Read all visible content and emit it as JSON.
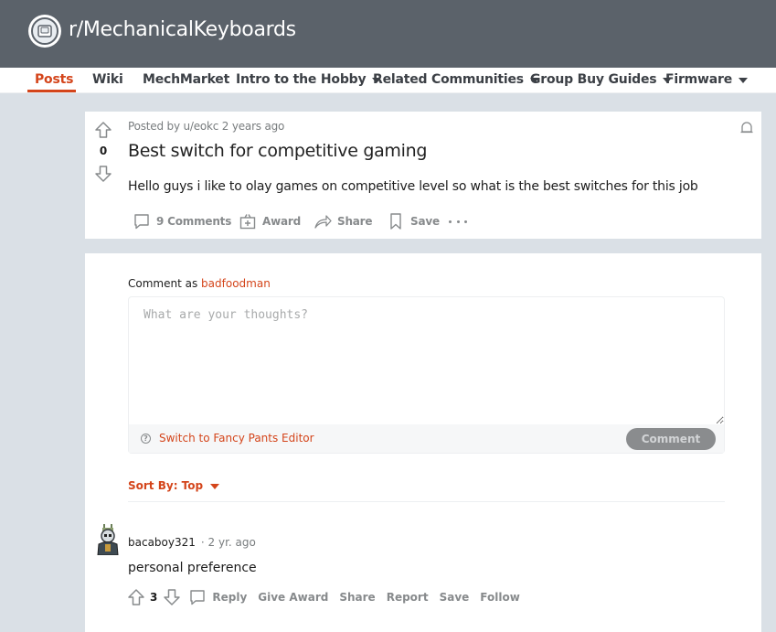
{
  "subreddit": {
    "title": "r/MechanicalKeyboards"
  },
  "nav": {
    "items": [
      {
        "label": "Posts",
        "active": true,
        "dropdown": false
      },
      {
        "label": "Wiki",
        "dropdown": false
      },
      {
        "label": "MechMarket",
        "dropdown": false
      },
      {
        "label": "Intro to the Hobby",
        "dropdown": true
      },
      {
        "label": "Related Communities",
        "dropdown": true
      },
      {
        "label": "Group Buy Guides",
        "dropdown": true
      },
      {
        "label": "Firmware",
        "dropdown": true
      }
    ]
  },
  "post": {
    "meta": "Posted by u/eokc 2 years ago",
    "score": "0",
    "title": "Best switch for competitive gaming",
    "body": "Hello guys i like to olay games on competitive level so what is the best switches for this job",
    "actions": {
      "comments": "9 Comments",
      "award": "Award",
      "share": "Share",
      "save": "Save"
    }
  },
  "comment_box": {
    "prefix": "Comment as",
    "username": "badfoodman",
    "placeholder": "What are your thoughts?",
    "fancy_editor": "Switch to Fancy Pants Editor",
    "submit": "Comment"
  },
  "sort": {
    "label": "Sort By: Top"
  },
  "comments": [
    {
      "username": "bacaboy321",
      "time": "· 2 yr. ago",
      "body": "personal preference",
      "score": "3",
      "actions": {
        "reply": "Reply",
        "give_award": "Give Award",
        "share": "Share",
        "report": "Report",
        "save": "Save",
        "follow": "Follow"
      }
    }
  ],
  "colors": {
    "accent": "#d4451b",
    "banner": "#5b626a",
    "background": "#dae0e6"
  }
}
